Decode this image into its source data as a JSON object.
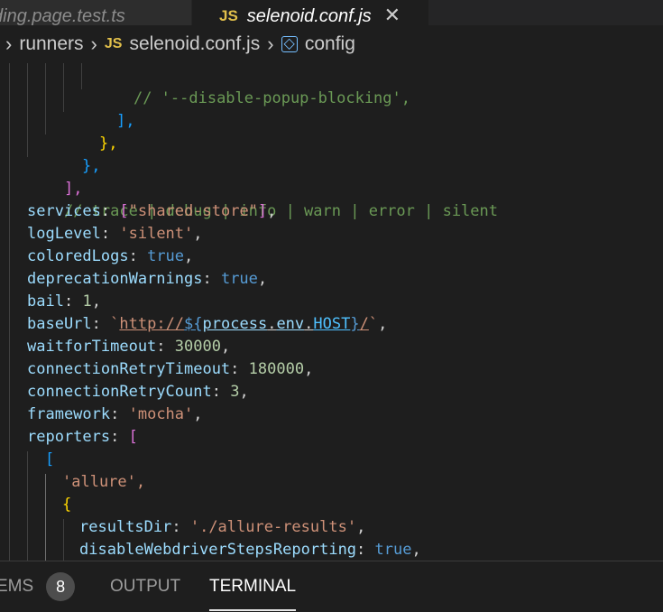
{
  "tabs": {
    "inactive_label": "ding.page.test.ts",
    "active_badge": "JS",
    "active_label": "selenoid.conf.js",
    "close_glyph": "✕"
  },
  "breadcrumb": {
    "folder": "runners",
    "file_badge": "JS",
    "file": "selenoid.conf.js",
    "symbol": "config",
    "separator": "›"
  },
  "code": {
    "l1_comment": "// '--disable-popup-blocking',",
    "l2_close": "],",
    "l3_close": "},",
    "l4_close": "},",
    "l5_close": "],",
    "l6_comment": "// trace | debug | info | warn | error | silent",
    "services_key": "services",
    "services_val": "\"shared-store\"",
    "logLevel_key": "logLevel",
    "logLevel_val": "'silent'",
    "coloredLogs_key": "coloredLogs",
    "coloredLogs_val": "true",
    "deprecation_key": "deprecationWarnings",
    "deprecation_val": "true",
    "bail_key": "bail",
    "bail_val": "1",
    "baseUrl_key": "baseUrl",
    "baseUrl_prefix": "http://",
    "baseUrl_obj": "process",
    "baseUrl_env": "env",
    "baseUrl_const": "HOST",
    "baseUrl_suffix": "/",
    "waitfor_key": "waitforTimeout",
    "waitfor_val": "30000",
    "connTimeout_key": "connectionRetryTimeout",
    "connTimeout_val": "180000",
    "connCount_key": "connectionRetryCount",
    "connCount_val": "3",
    "framework_key": "framework",
    "framework_val": "'mocha'",
    "reporters_key": "reporters",
    "allure_val": "'allure',",
    "resultsDir_key": "resultsDir",
    "resultsDir_val": "'./allure-results'",
    "disableSteps_key": "disableWebdriverStepsReporting",
    "disableSteps_val": "true"
  },
  "panel": {
    "problems_label": "EMS",
    "problems_count": "8",
    "output_label": "OUTPUT",
    "terminal_label": "TERMINAL"
  },
  "colors": {
    "editor_bg": "#1e1e1e",
    "comment": "#6a9955",
    "property": "#9cdcfe",
    "string": "#ce9178",
    "keyword": "#569cd6",
    "number": "#b5cea8",
    "js_badge": "#e2c04b"
  },
  "icons": [
    "close-icon",
    "chevron-right-icon",
    "js-file-icon",
    "symbol-variable-icon"
  ]
}
